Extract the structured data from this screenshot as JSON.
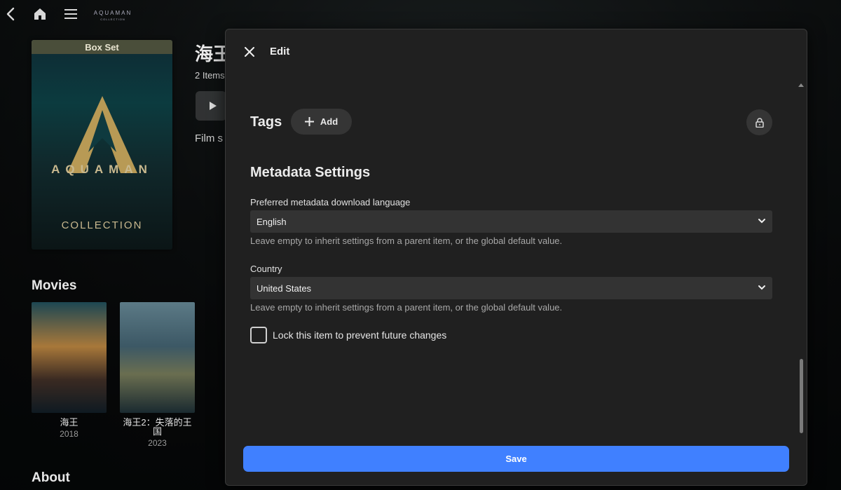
{
  "background": {
    "brand": {
      "line1": "AQUAMAN",
      "line2": "COLLECTION"
    },
    "poster": {
      "ribbon": "Box Set",
      "title": "AQUAMAN",
      "subtitle": "COLLECTION"
    },
    "title": "海王",
    "count": "2 Items",
    "overview_start": "Film s",
    "movies_heading": "Movies",
    "about_heading": "About",
    "movies": [
      {
        "title": "海王",
        "year": "2018"
      },
      {
        "title": "海王2：失落的王国",
        "year": "2023"
      }
    ]
  },
  "dialog": {
    "title": "Edit",
    "tags_label": "Tags",
    "add_label": "Add",
    "metadata_heading": "Metadata Settings",
    "language": {
      "label": "Preferred metadata download language",
      "value": "English",
      "helper": "Leave empty to inherit settings from a parent item, or the global default value."
    },
    "country": {
      "label": "Country",
      "value": "United States",
      "helper": "Leave empty to inherit settings from a parent item, or the global default value."
    },
    "lock_label": "Lock this item to prevent future changes",
    "lock_checked": false,
    "save_label": "Save"
  },
  "colors": {
    "accent": "#4080ff",
    "dialog_bg": "#202020",
    "field_bg": "#333333"
  },
  "icons": [
    "back-arrow-icon",
    "home-icon",
    "hamburger-menu-icon",
    "close-icon",
    "plus-icon",
    "lock-icon",
    "chevron-down-icon",
    "play-icon",
    "scroll-up-icon"
  ]
}
